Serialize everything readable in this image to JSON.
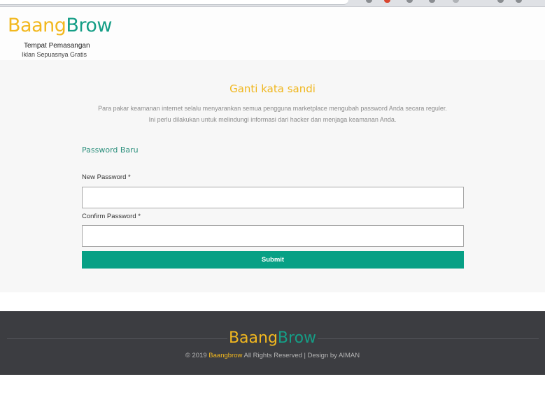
{
  "header": {
    "logo_part1": "Baang",
    "logo_part2": "Brow",
    "tagline1": "Tempat Pemasangan",
    "tagline2": "Iklan Sepuasnya Gratis"
  },
  "main": {
    "title": "Ganti kata sandi",
    "description_line1": "Para pakar keamanan internet selalu menyarankan semua pengguna marketplace mengubah password Anda secara reguler.",
    "description_line2": "Ini perlu dilakukan untuk melindungi informasi dari hacker dan menjaga keamanan Anda.",
    "section_label": "Password Baru",
    "new_password_label": "New Password *",
    "new_password_value": "",
    "confirm_password_label": "Confirm Password *",
    "confirm_password_value": "",
    "submit_label": "Submit"
  },
  "footer": {
    "logo_part1": "Baang",
    "logo_part2": "Brow",
    "copyright_prefix": "© 2019",
    "copyright_brand": "Baangbrow",
    "copyright_suffix": "All Rights Reserved | Design by AIMAN"
  },
  "colors": {
    "brand_yellow": "#f2b81f",
    "brand_teal": "#159e86",
    "submit_button": "#07a085",
    "footer_bg": "#3c3d41"
  }
}
